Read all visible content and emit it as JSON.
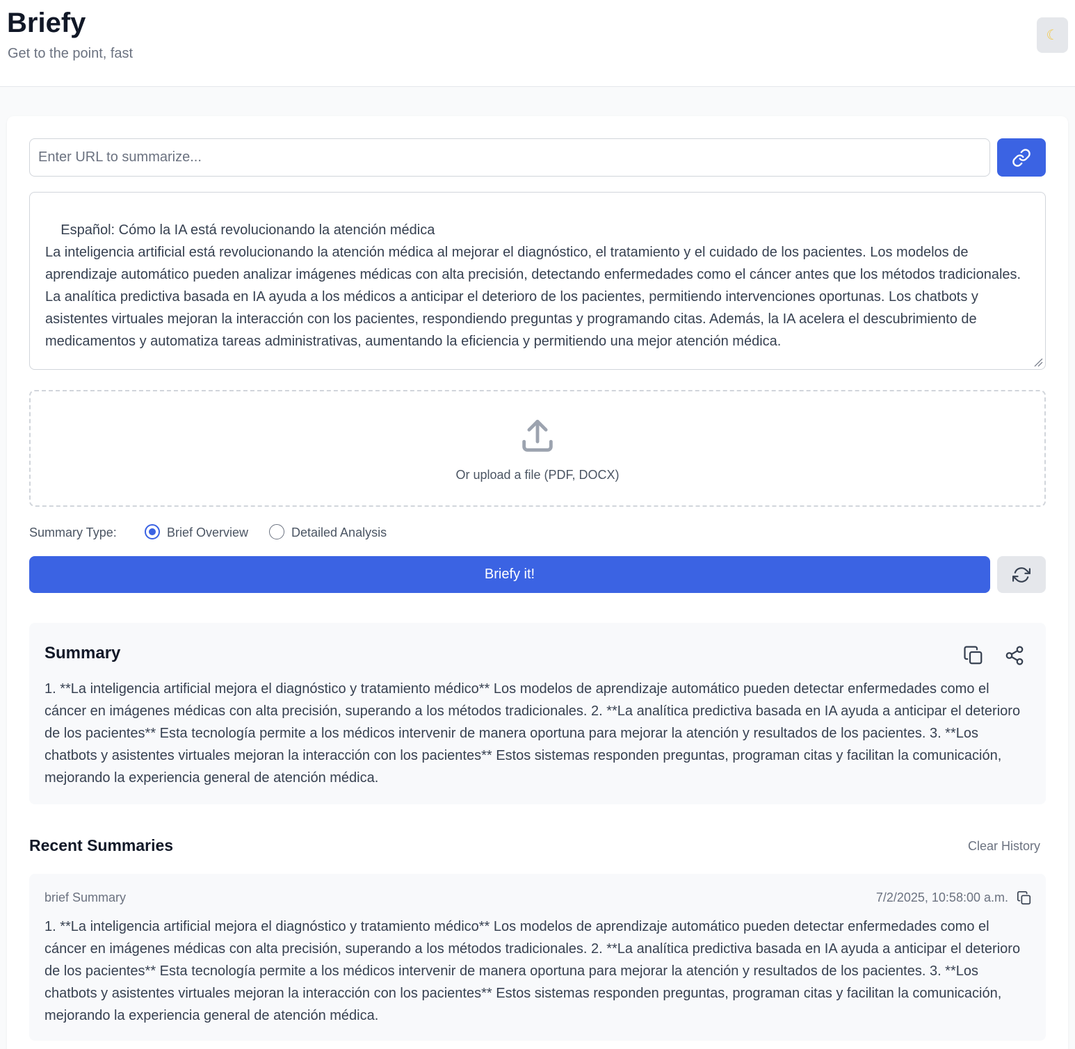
{
  "app": {
    "title": "Briefy",
    "subtitle": "Get to the point, fast",
    "theme_icon": "moon-icon"
  },
  "colors": {
    "accent": "#3b63e3",
    "background": "#f9fafb",
    "panel": "#f8f9fb"
  },
  "input": {
    "url_placeholder": "Enter URL to summarize...",
    "url_value": "",
    "text_value": "Español: Cómo la IA está revolucionando la atención médica\nLa inteligencia artificial está revolucionando la atención médica al mejorar el diagnóstico, el tratamiento y el cuidado de los pacientes. Los modelos de aprendizaje automático pueden analizar imágenes médicas con alta precisión, detectando enfermedades como el cáncer antes que los métodos tradicionales. La analítica predictiva basada en IA ayuda a los médicos a anticipar el deterioro de los pacientes, permitiendo intervenciones oportunas. Los chatbots y asistentes virtuales mejoran la interacción con los pacientes, respondiendo preguntas y programando citas. Además, la IA acelera el descubrimiento de medicamentos y automatiza tareas administrativas, aumentando la eficiencia y permitiendo una mejor atención médica.",
    "upload_label": "Or upload a file (PDF, DOCX)"
  },
  "summary_type": {
    "label": "Summary Type:",
    "options": [
      {
        "label": "Brief Overview",
        "selected": true
      },
      {
        "label": "Detailed Analysis",
        "selected": false
      }
    ]
  },
  "actions": {
    "submit_label": "Briefy it!"
  },
  "summary": {
    "title": "Summary",
    "text": "1. **La inteligencia artificial mejora el diagnóstico y tratamiento médico** Los modelos de aprendizaje automático pueden detectar enfermedades como el cáncer en imágenes médicas con alta precisión, superando a los métodos tradicionales. 2. **La analítica predictiva basada en IA ayuda a anticipar el deterioro de los pacientes** Esta tecnología permite a los médicos intervenir de manera oportuna para mejorar la atención y resultados de los pacientes. 3. **Los chatbots y asistentes virtuales mejoran la interacción con los pacientes** Estos sistemas responden preguntas, programan citas y facilitan la comunicación, mejorando la experiencia general de atención médica."
  },
  "recent": {
    "title": "Recent Summaries",
    "clear_label": "Clear History",
    "items": [
      {
        "type": "brief Summary",
        "date": "7/2/2025, 10:58:00 a.m.",
        "text": "1. **La inteligencia artificial mejora el diagnóstico y tratamiento médico** Los modelos de aprendizaje automático pueden detectar enfermedades como el cáncer en imágenes médicas con alta precisión, superando a los métodos tradicionales. 2. **La analítica predictiva basada en IA ayuda a anticipar el deterioro de los pacientes** Esta tecnología permite a los médicos intervenir de manera oportuna para mejorar la atención y resultados de los pacientes. 3. **Los chatbots y asistentes virtuales mejoran la interacción con los pacientes** Estos sistemas responden preguntas, programan citas y facilitan la comunicación, mejorando la experiencia general de atención médica."
      }
    ]
  }
}
